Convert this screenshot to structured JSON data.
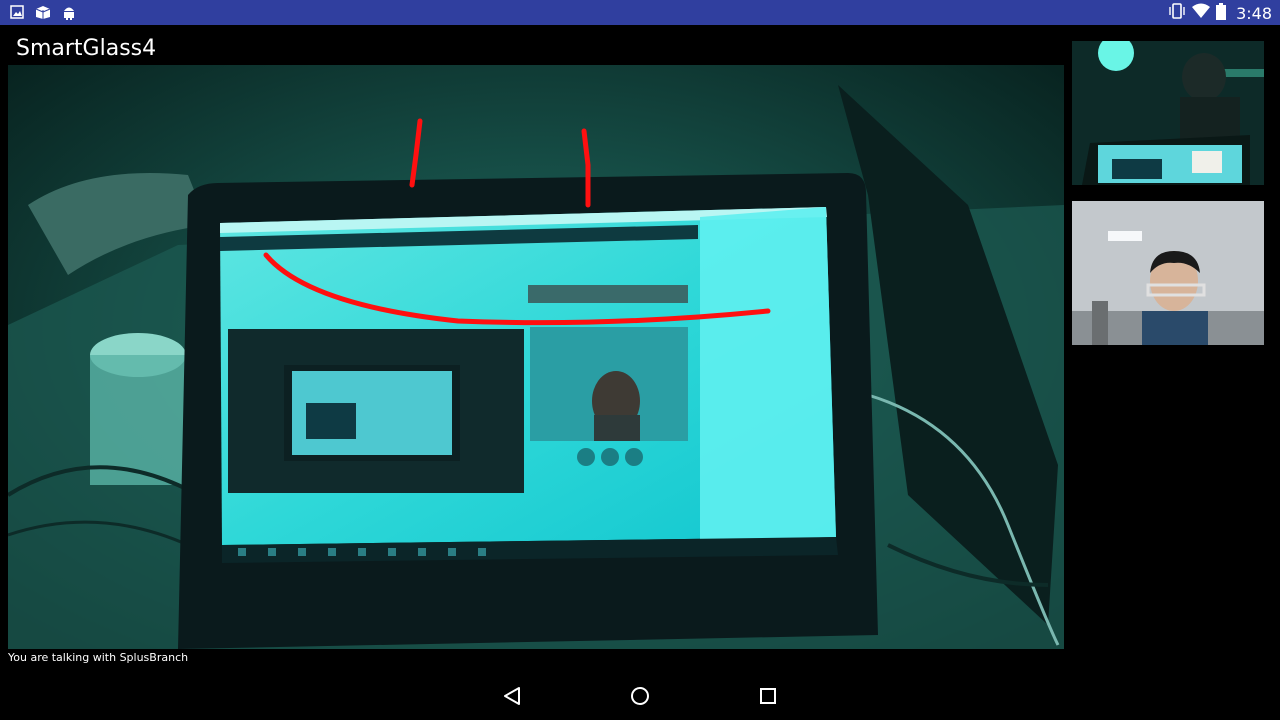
{
  "status_bar": {
    "time": "3:48",
    "left_icons": [
      "image-icon",
      "box-icon",
      "android-icon"
    ],
    "right_icons": [
      "vibrate-icon",
      "wifi-icon",
      "battery-icon"
    ],
    "color": "#303f9f"
  },
  "app": {
    "title": "SmartGlass4"
  },
  "video": {
    "caption": "You are talking with SplusBranch"
  },
  "nav_bar": {
    "buttons": [
      "back-icon",
      "home-icon",
      "recents-icon"
    ]
  }
}
